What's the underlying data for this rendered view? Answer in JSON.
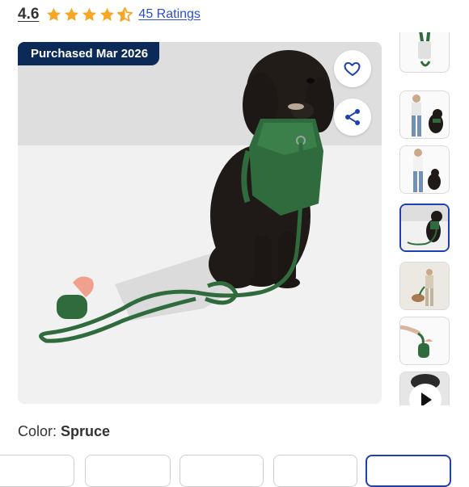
{
  "rating": {
    "score": "4.6",
    "stars_value": 4.6,
    "stars_max": 5,
    "ratings_link": "45 Ratings",
    "star_color": "#f5a623"
  },
  "gallery": {
    "badge": "Purchased Mar 2026",
    "badge_color": "#0b2a57",
    "favorite_icon": "heart-icon",
    "share_icon": "share-icon",
    "thumbnails": [
      {
        "name": "thumb-leash"
      },
      {
        "name": "thumb-person-dog-walk"
      },
      {
        "name": "thumb-person-dog-stand"
      },
      {
        "name": "thumb-dog-harness",
        "selected": true
      },
      {
        "name": "thumb-walking-city"
      },
      {
        "name": "thumb-poop-bag-holder"
      },
      {
        "name": "thumb-video",
        "icon": "play-icon"
      }
    ],
    "selected_border_color": "#1f3fb3"
  },
  "color": {
    "label": "Color:",
    "value": "Spruce",
    "selected_index": 4
  }
}
